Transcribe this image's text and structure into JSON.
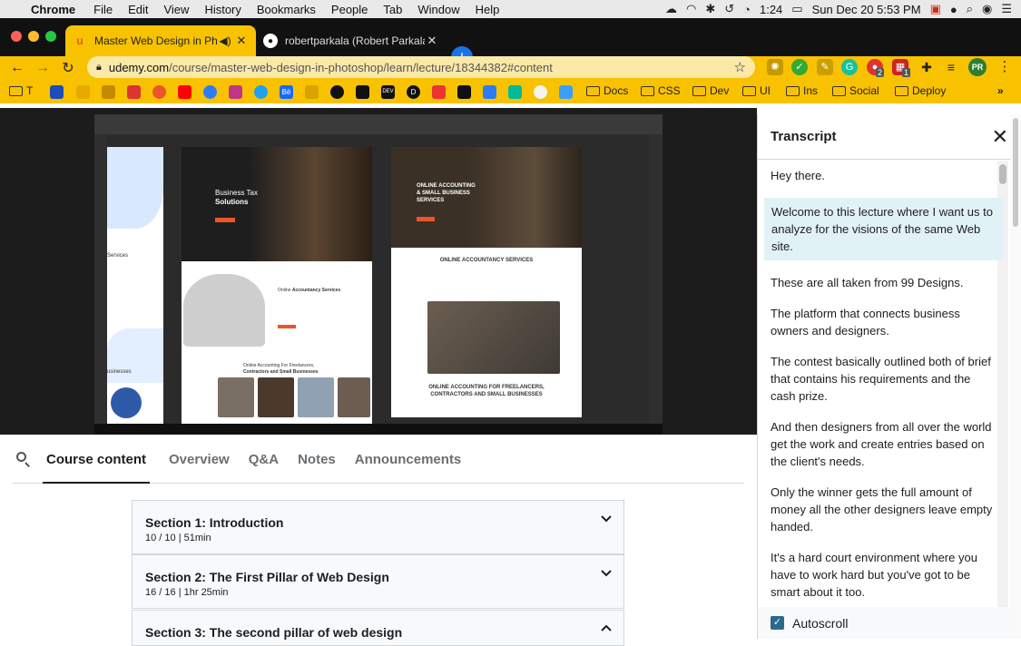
{
  "menubar": {
    "app_name": "Chrome",
    "items": [
      "File",
      "Edit",
      "View",
      "History",
      "Bookmarks",
      "People",
      "Tab",
      "Window",
      "Help"
    ],
    "time": "1:24",
    "datetime": "Sun Dec 20  5:53 PM"
  },
  "tabs": [
    {
      "title": "Master Web Design in Phot",
      "active": true
    },
    {
      "title": "robertparkala (Robert Parkala)",
      "active": false
    }
  ],
  "url": {
    "host": "udemy.com",
    "path": "/course/master-web-design-in-photoshop/learn/lecture/18344382#content"
  },
  "bookmarks": {
    "first_label": "T",
    "folders": [
      "Docs",
      "CSS",
      "Dev",
      "UI",
      "Ins",
      "Social",
      "Deploy"
    ],
    "overflow": "»",
    "icon_labels": [
      "Bē",
      "DEV",
      "D"
    ]
  },
  "profile_initials": "PR",
  "ext_badges": [
    "2",
    "1"
  ],
  "video": {
    "mock_left": {
      "hero_title_1": "Business Tax",
      "hero_title_2": "Solutions",
      "services_heading_pre": "Online ",
      "services_heading": "Accountancy Services",
      "footer_1": "Online Accounting For Freelancers,",
      "footer_2": "Contractors and Small Businesses",
      "sidebar_label_1": "Services",
      "sidebar_label_2": "usinesses"
    },
    "mock_right": {
      "hero_title_1": "ONLINE ACCOUNTING",
      "hero_title_2": "& SMALL BUSINESS",
      "hero_title_3": "SERVICES",
      "services_heading": "ONLINE ACCOUNTANCY SERVICES",
      "footer_1": "ONLINE ACCOUNTING FOR FREELANCERS,",
      "footer_2": "CONTRACTORS AND SMALL BUSINESSES"
    }
  },
  "transcript": {
    "title": "Transcript",
    "cues": [
      "Hey there.",
      "Welcome to this lecture where I want us to analyze for the visions of the same Web site.",
      "These are all taken from 99 Designs.",
      "The platform that connects business owners and designers.",
      "The contest basically outlined both of brief that contains his requirements and the cash prize.",
      "And then designers from all over the world get the work and create entries based on the client's needs.",
      "Only the winner gets the full amount of money all the other designers leave empty handed.",
      "It's a hard court environment where you have to work hard but you've got to be smart about it too."
    ],
    "active_cue": 1,
    "autoscroll_label": "Autoscroll",
    "autoscroll_checked": true
  },
  "course_tabs": [
    "Course content",
    "Overview",
    "Q&A",
    "Notes",
    "Announcements"
  ],
  "sections": [
    {
      "title": "Section 1: Introduction",
      "meta": "10 / 10 | 51min",
      "expanded": false
    },
    {
      "title": "Section 2: The First Pillar of Web Design",
      "meta": "16 / 16 | 1hr 25min",
      "expanded": false
    },
    {
      "title": "Section 3: The second pillar of web design",
      "meta": "",
      "expanded": true
    }
  ],
  "colors": {
    "chrome_theme": "#f8c200",
    "udemy_text": "#1c1d1f",
    "accent_orange": "#e8562a",
    "checkbox": "#2d6a8a"
  }
}
